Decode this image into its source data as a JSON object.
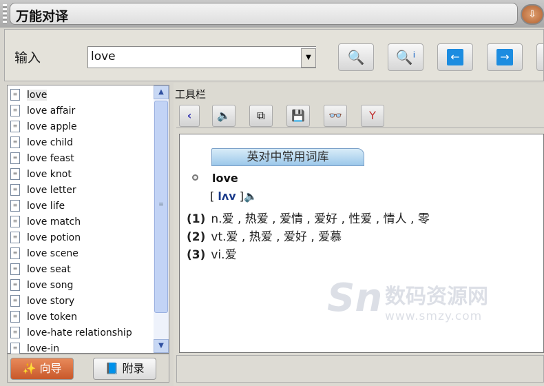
{
  "window": {
    "title": "万能对译"
  },
  "input": {
    "label": "输入",
    "value": "love"
  },
  "toolbar_buttons": [
    {
      "name": "search",
      "icon": "magnifier-icon"
    },
    {
      "name": "search-info",
      "icon": "magnifier-info-icon"
    },
    {
      "name": "back",
      "icon": "arrow-left-icon"
    },
    {
      "name": "forward",
      "icon": "arrow-right-icon"
    }
  ],
  "word_list": {
    "items": [
      "love",
      "love affair",
      "love apple",
      "love child",
      "love feast",
      "love knot",
      "love letter",
      "love life",
      "love match",
      "love potion",
      "love scene",
      "love seat",
      "love song",
      "love story",
      "love token",
      "love-hate relationship",
      "love-in"
    ],
    "selected": "love"
  },
  "left_buttons": {
    "guide": "向导",
    "appendix": "附录"
  },
  "right_toolbar": {
    "label": "工具栏",
    "buttons": [
      "back-icon",
      "speaker-icon",
      "copy-icon",
      "save-icon",
      "binoculars-icon",
      "filter-icon"
    ]
  },
  "entry": {
    "dictionary": "英对中常用词库",
    "headword": "love",
    "phonetic": "lʌv",
    "definitions": [
      {
        "num": "(1)",
        "text": "n.爱 , 热爱 , 爱情 , 爱好 , 性爱 , 情人 , 零"
      },
      {
        "num": "(2)",
        "text": "vt.爱 , 热爱 , 爱好 , 爱慕"
      },
      {
        "num": "(3)",
        "text": "vi.爱"
      }
    ]
  },
  "watermark": {
    "name": "数码资源网",
    "url": "www.smzy.com"
  }
}
